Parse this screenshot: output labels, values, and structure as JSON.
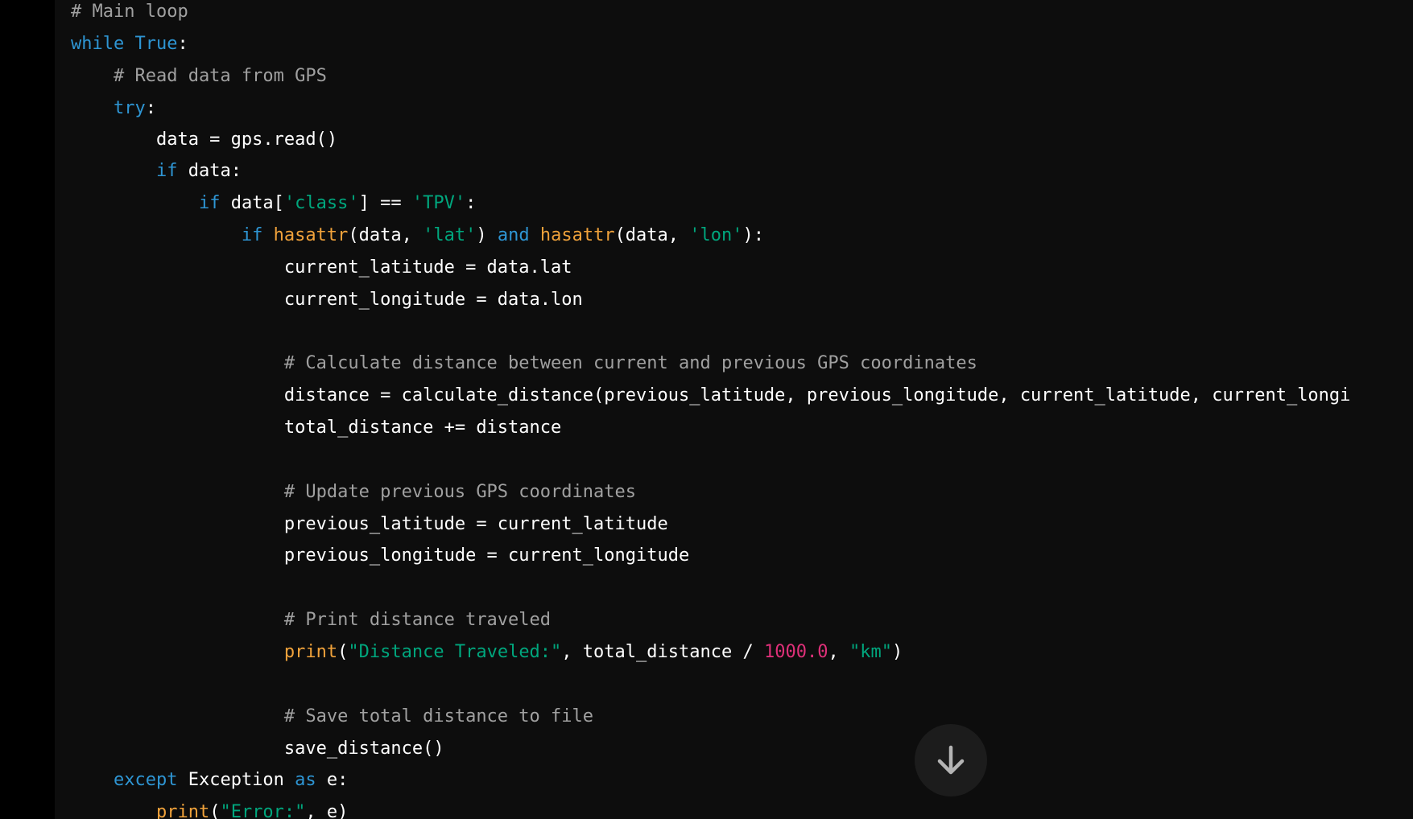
{
  "code": {
    "lines": [
      {
        "id": "l0",
        "tokens": [
          {
            "t": "cm",
            "v": "# Main loop"
          }
        ]
      },
      {
        "id": "l1",
        "tokens": [
          {
            "t": "kw",
            "v": "while"
          },
          {
            "t": "tx",
            "v": " "
          },
          {
            "t": "kw",
            "v": "True"
          },
          {
            "t": "tx",
            "v": ":"
          }
        ]
      },
      {
        "id": "l2",
        "tokens": [
          {
            "t": "cm",
            "v": "    # Read data from GPS"
          }
        ]
      },
      {
        "id": "l3",
        "tokens": [
          {
            "t": "tx",
            "v": "    "
          },
          {
            "t": "kw",
            "v": "try"
          },
          {
            "t": "tx",
            "v": ":"
          }
        ]
      },
      {
        "id": "l4",
        "tokens": [
          {
            "t": "tx",
            "v": "        data = gps.read()"
          }
        ]
      },
      {
        "id": "l5",
        "tokens": [
          {
            "t": "tx",
            "v": "        "
          },
          {
            "t": "kw",
            "v": "if"
          },
          {
            "t": "tx",
            "v": " data:"
          }
        ]
      },
      {
        "id": "l6",
        "tokens": [
          {
            "t": "tx",
            "v": "            "
          },
          {
            "t": "kw",
            "v": "if"
          },
          {
            "t": "tx",
            "v": " data["
          },
          {
            "t": "st",
            "v": "'class'"
          },
          {
            "t": "tx",
            "v": "] == "
          },
          {
            "t": "st",
            "v": "'TPV'"
          },
          {
            "t": "tx",
            "v": ":"
          }
        ]
      },
      {
        "id": "l7",
        "tokens": [
          {
            "t": "tx",
            "v": "                "
          },
          {
            "t": "kw",
            "v": "if"
          },
          {
            "t": "tx",
            "v": " "
          },
          {
            "t": "fn",
            "v": "hasattr"
          },
          {
            "t": "tx",
            "v": "(data, "
          },
          {
            "t": "st",
            "v": "'lat'"
          },
          {
            "t": "tx",
            "v": ") "
          },
          {
            "t": "kw",
            "v": "and"
          },
          {
            "t": "tx",
            "v": " "
          },
          {
            "t": "fn",
            "v": "hasattr"
          },
          {
            "t": "tx",
            "v": "(data, "
          },
          {
            "t": "st",
            "v": "'lon'"
          },
          {
            "t": "tx",
            "v": "):"
          }
        ]
      },
      {
        "id": "l8",
        "tokens": [
          {
            "t": "tx",
            "v": "                    current_latitude = data.lat"
          }
        ]
      },
      {
        "id": "l9",
        "tokens": [
          {
            "t": "tx",
            "v": "                    current_longitude = data.lon"
          }
        ]
      },
      {
        "id": "l10",
        "tokens": [
          {
            "t": "cm",
            "v": "                    # Calculate distance between current and previous GPS coordinates"
          }
        ]
      },
      {
        "id": "l11",
        "tokens": [
          {
            "t": "tx",
            "v": "                    distance = calculate_distance(previous_latitude, previous_longitude, current_latitude, current_longi"
          }
        ]
      },
      {
        "id": "l12",
        "tokens": [
          {
            "t": "tx",
            "v": "                    total_distance += distance"
          }
        ]
      },
      {
        "id": "l13",
        "tokens": [
          {
            "t": "cm",
            "v": "                    # Update previous GPS coordinates"
          }
        ]
      },
      {
        "id": "l14",
        "tokens": [
          {
            "t": "tx",
            "v": "                    previous_latitude = current_latitude"
          }
        ]
      },
      {
        "id": "l15",
        "tokens": [
          {
            "t": "tx",
            "v": "                    previous_longitude = current_longitude"
          }
        ]
      },
      {
        "id": "l16",
        "tokens": [
          {
            "t": "cm",
            "v": "                    # Print distance traveled"
          }
        ]
      },
      {
        "id": "l17",
        "tokens": [
          {
            "t": "tx",
            "v": "                    "
          },
          {
            "t": "fn",
            "v": "print"
          },
          {
            "t": "tx",
            "v": "("
          },
          {
            "t": "st",
            "v": "\"Distance Traveled:\""
          },
          {
            "t": "tx",
            "v": ", total_distance / "
          },
          {
            "t": "nm",
            "v": "1000.0"
          },
          {
            "t": "tx",
            "v": ", "
          },
          {
            "t": "st",
            "v": "\"km\""
          },
          {
            "t": "tx",
            "v": ")"
          }
        ]
      },
      {
        "id": "l18",
        "tokens": [
          {
            "t": "cm",
            "v": "                    # Save total distance to file"
          }
        ]
      },
      {
        "id": "l19",
        "tokens": [
          {
            "t": "tx",
            "v": "                    save_distance()"
          }
        ]
      },
      {
        "id": "l20",
        "tokens": [
          {
            "t": "tx",
            "v": "    "
          },
          {
            "t": "kw",
            "v": "except"
          },
          {
            "t": "tx",
            "v": " Exception "
          },
          {
            "t": "kw",
            "v": "as"
          },
          {
            "t": "tx",
            "v": " e:"
          }
        ]
      },
      {
        "id": "l21",
        "tokens": [
          {
            "t": "tx",
            "v": "        "
          },
          {
            "t": "fn",
            "v": "print"
          },
          {
            "t": "tx",
            "v": "("
          },
          {
            "t": "st",
            "v": "\"Error:\""
          },
          {
            "t": "tx",
            "v": ", e)"
          }
        ]
      }
    ]
  },
  "scroll_button": {
    "icon": "arrow-down-icon"
  },
  "colors": {
    "keyword": "#2e95d3",
    "function": "#f0a23b",
    "string": "#00a67d",
    "number": "#df3079",
    "comment": "#a0a0a0",
    "text": "#ffffff",
    "background": "#0d0d0d"
  }
}
